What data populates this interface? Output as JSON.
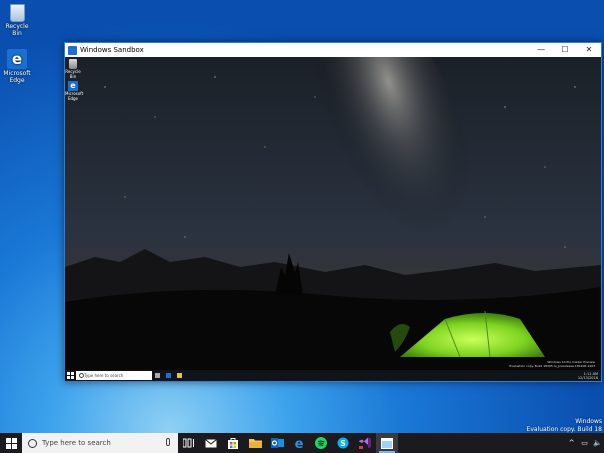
{
  "desktop": {
    "icons": [
      {
        "label": "Recycle Bin",
        "icon": "recycle-bin-icon"
      },
      {
        "label": "Microsoft Edge",
        "icon": "edge-icon"
      }
    ],
    "watermark": {
      "line1": "Windows",
      "line2": "Evaluation copy. Build 18"
    }
  },
  "sandbox": {
    "title": "Windows Sandbox",
    "controls": {
      "minimize": "—",
      "maximize": "☐",
      "close": "✕"
    },
    "inner_icons": [
      {
        "label": "Recycle Bin",
        "icon": "recycle-bin-icon"
      },
      {
        "label": "Microsoft Edge",
        "icon": "edge-icon"
      }
    ],
    "inner_watermark": {
      "line1": "Windows 10 Pro Insider Preview",
      "line2": "Evaluation copy. Build 18305.rs_prerelease.181206-1403"
    },
    "inner_taskbar": {
      "search_placeholder": "Type here to search",
      "clock": {
        "time": "1:11 AM",
        "date": "12/13/2018"
      }
    }
  },
  "taskbar": {
    "search_placeholder": "Type here to search",
    "pinned": [
      {
        "name": "task-view",
        "icon": "task-view-icon"
      },
      {
        "name": "mail",
        "icon": "mail-icon"
      },
      {
        "name": "store",
        "icon": "store-icon"
      },
      {
        "name": "file-explorer",
        "icon": "folder-icon"
      },
      {
        "name": "outlook",
        "icon": "outlook-icon"
      },
      {
        "name": "edge",
        "icon": "edge-icon"
      },
      {
        "name": "spotify",
        "icon": "spotify-icon"
      },
      {
        "name": "skype",
        "icon": "skype-icon"
      },
      {
        "name": "visual-studio",
        "icon": "visual-studio-icon"
      },
      {
        "name": "windows-sandbox",
        "icon": "sandbox-icon",
        "active": true
      }
    ],
    "tray": [
      {
        "name": "chevron-up",
        "icon": "chevron-up-icon",
        "glyph": "^"
      },
      {
        "name": "network",
        "icon": "network-icon",
        "glyph": "▭"
      },
      {
        "name": "volume",
        "icon": "volume-icon",
        "glyph": "🔈"
      }
    ]
  },
  "colors": {
    "desktop_blue": "#1a78d6",
    "taskbar": "#1a1a1f",
    "tent_green": "#7ed321",
    "sky_glow": "#e8662a"
  }
}
